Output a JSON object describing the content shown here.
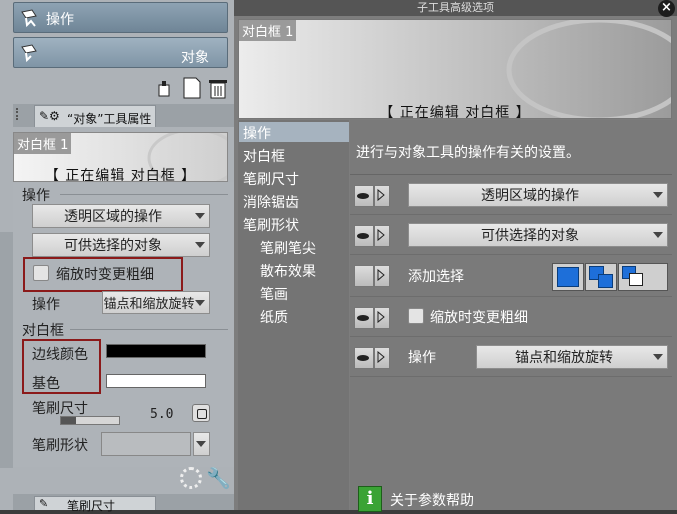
{
  "left": {
    "subtools": [
      {
        "label": "操作",
        "icon": "operation-icon"
      },
      {
        "label": "对象",
        "icon": "object-icon"
      }
    ],
    "tool_property_tab": "“对象”工具属性",
    "preview": {
      "chip": "对白框 1",
      "title": "【 正在编辑 对白框 】"
    },
    "section_operation": "操作",
    "dropdown_transparent": "透明区域的操作",
    "dropdown_selectable": "可供选择的对象",
    "checkbox_scale_label": "缩放时变更粗细",
    "operation_label": "操作",
    "operation_value": "锚点和缩放旋转",
    "section_balloon": "对白框",
    "border_color_label": "边线颜色",
    "fill_color_label": "基色",
    "border_color": "#000000",
    "fill_color": "#ffffff",
    "brush_size_label": "笔刷尺寸",
    "brush_size_value": "5.0",
    "brush_size_fraction": 0.25,
    "brush_shape_label": "笔刷形状",
    "bottom_tab": "笔刷尺寸"
  },
  "dialog": {
    "title": "子工具高级选项",
    "close": "×",
    "preview": {
      "chip": "对白框 1",
      "title": "【 正在编辑 对白框 】"
    },
    "nav": [
      {
        "label": "操作",
        "sub": false,
        "selected": true
      },
      {
        "label": "对白框",
        "sub": false
      },
      {
        "label": "笔刷尺寸",
        "sub": false
      },
      {
        "label": "消除锯齿",
        "sub": false
      },
      {
        "label": "笔刷形状",
        "sub": false
      },
      {
        "label": "笔刷笔尖",
        "sub": true
      },
      {
        "label": "散布效果",
        "sub": true
      },
      {
        "label": "笔画",
        "sub": true
      },
      {
        "label": "纸质",
        "sub": true
      }
    ],
    "description": "进行与对象工具的操作有关的设置。",
    "rows": {
      "transparent": "透明区域的操作",
      "selectable": "可供选择的对象",
      "add_selection": "添加选择",
      "scale_checkbox": "缩放时变更粗细",
      "operation_label": "操作",
      "operation_value": "锚点和缩放旋转"
    },
    "help": "关于参数帮助",
    "accent": "#1e6fd9"
  }
}
